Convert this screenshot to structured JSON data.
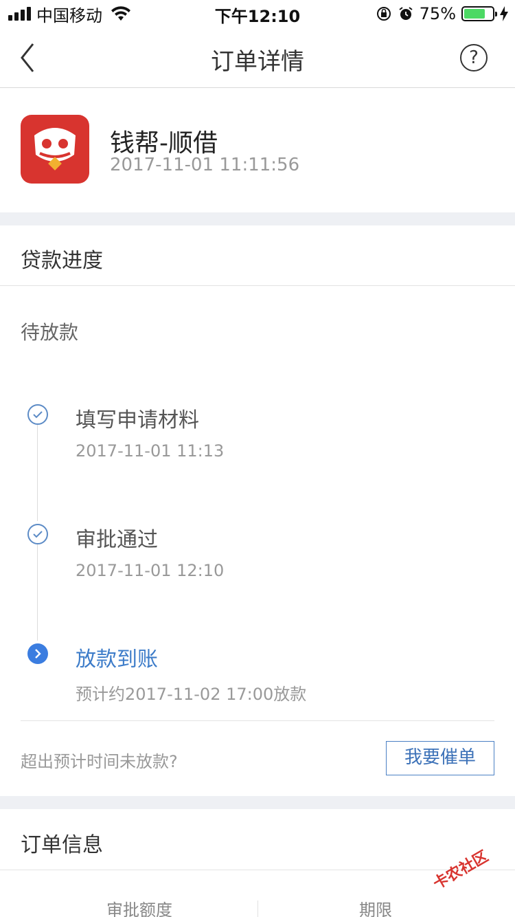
{
  "status_bar": {
    "carrier": "中国移动",
    "time": "下午12:10",
    "battery_pct": "75%",
    "battery_level": 0.75
  },
  "nav": {
    "title": "订单详情",
    "help_glyph": "?"
  },
  "app": {
    "name": "钱帮-顺借",
    "time": "2017-11-01 11:11:56"
  },
  "loan_progress": {
    "title": "贷款进度",
    "status": "待放款",
    "steps": [
      {
        "title": "填写申请材料",
        "sub": "2017-11-01 11:13",
        "state": "done"
      },
      {
        "title": "审批通过",
        "sub": "2017-11-01 12:10",
        "state": "done"
      },
      {
        "title": "放款到账",
        "sub": "预计约2017-11-02 17:00放款",
        "state": "active"
      }
    ],
    "overdue_question": "超出预计时间未放款?",
    "urge_button": "我要催单"
  },
  "order_info": {
    "title": "订单信息",
    "columns": [
      "审批额度",
      "期限"
    ]
  },
  "watermark": {
    "text": "卡农社区"
  },
  "colors": {
    "accent": "#3d7cc9",
    "logo_red": "#d8342f",
    "section_gap": "#eef0f4"
  }
}
